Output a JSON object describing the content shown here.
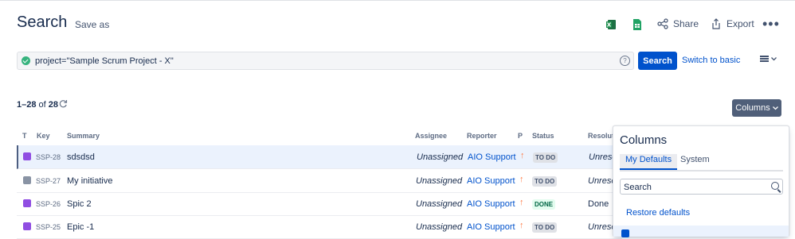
{
  "header": {
    "title": "Search",
    "save_as": "Save as",
    "share_label": "Share",
    "export_label": "Export",
    "more_label": "•••",
    "excel_icon": "excel-icon",
    "sheet_icon": "google-sheet-icon"
  },
  "query": {
    "jql": "project=\"Sample Scrum Project - X\"",
    "help": "?",
    "search_label": "Search",
    "switch_label": "Switch to basic"
  },
  "results": {
    "range": "1–28",
    "of_label": "of",
    "total": "28",
    "columns_label": "Columns"
  },
  "table": {
    "headers": {
      "t": "T",
      "key": "Key",
      "summary": "Summary",
      "assignee": "Assignee",
      "reporter": "Reporter",
      "p": "P",
      "status": "Status",
      "resolution": "Resolut"
    },
    "rows": [
      {
        "key": "SSP-28",
        "summary": "sdsdsd",
        "assignee": "Unassigned",
        "reporter": "AIO Support",
        "priority": "↑",
        "status": "TO DO",
        "resolution": "Unreso",
        "type": "epic"
      },
      {
        "key": "SSP-27",
        "summary": "My initiative",
        "assignee": "Unassigned",
        "reporter": "AIO Support",
        "priority": "↑",
        "status": "TO DO",
        "resolution": "Unreso",
        "type": "initiative"
      },
      {
        "key": "SSP-26",
        "summary": "Spic 2",
        "assignee": "Unassigned",
        "reporter": "AIO Support",
        "priority": "↑",
        "status": "DONE",
        "resolution": "Done",
        "type": "epic"
      },
      {
        "key": "SSP-25",
        "summary": "Epic -1",
        "assignee": "Unassigned",
        "reporter": "AIO Support",
        "priority": "↑",
        "status": "TO DO",
        "resolution": "Unreso",
        "type": "epic"
      }
    ]
  },
  "columns_panel": {
    "title": "Columns",
    "tab_defaults": "My Defaults",
    "tab_system": "System",
    "search_placeholder": "Search",
    "restore_label": "Restore defaults"
  },
  "colors": {
    "primary": "#0052cc",
    "columns_button": "#505f79",
    "done": "#006644",
    "priority": "#ff7a45"
  }
}
